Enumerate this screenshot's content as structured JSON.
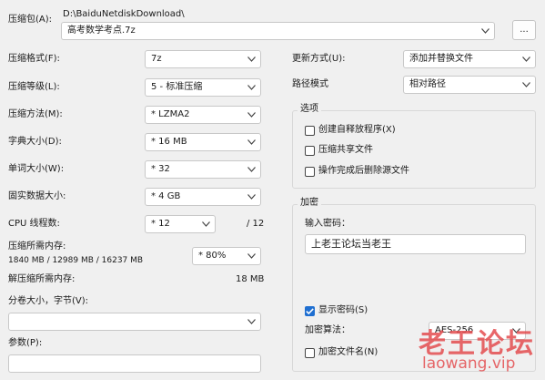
{
  "archive": {
    "label": "压缩包(A):",
    "path": "D:\\BaiduNetdiskDownload\\",
    "filename": "高考数学考点.7z",
    "browse_label": "..."
  },
  "left": {
    "format": {
      "label": "压缩格式(F):",
      "value": "7z"
    },
    "level": {
      "label": "压缩等级(L):",
      "value": "5 - 标准压缩"
    },
    "method": {
      "label": "压缩方法(M):",
      "value": "* LZMA2"
    },
    "dict": {
      "label": "字典大小(D):",
      "value": "* 16 MB"
    },
    "word": {
      "label": "单词大小(W):",
      "value": "* 32"
    },
    "solid": {
      "label": "固实数据大小:",
      "value": "* 4 GB"
    },
    "cpu": {
      "label": "CPU 线程数:",
      "value": "* 12",
      "total": "/ 12"
    },
    "memory": {
      "label": "压缩所需内存:",
      "detail": "1840 MB / 12989 MB / 16237 MB",
      "value": "* 80%"
    },
    "decomp": {
      "label": "解压缩所需内存:",
      "value": "18 MB"
    },
    "volume": {
      "label": "分卷大小，字节(V):",
      "value": ""
    },
    "params": {
      "label": "参数(P):",
      "value": ""
    }
  },
  "right": {
    "update": {
      "label": "更新方式(U):",
      "value": "添加并替换文件"
    },
    "pathmode": {
      "label": "路径模式",
      "value": "相对路径"
    },
    "options": {
      "title": "选项",
      "sfx": {
        "label": "创建自释放程序(X)",
        "checked": false
      },
      "shared": {
        "label": "压缩共享文件",
        "checked": false
      },
      "delete": {
        "label": "操作完成后删除源文件",
        "checked": false
      }
    },
    "encryption": {
      "title": "加密",
      "password_label": "输入密码：",
      "password_value": "上老王论坛当老王",
      "show_password": {
        "label": "显示密码(S)",
        "checked": true
      },
      "method_label": "加密算法：",
      "method_value": "AES-256",
      "encrypt_names": {
        "label": "加密文件名(N)",
        "checked": false
      }
    }
  },
  "watermark": {
    "line1": "老王论坛",
    "line2": "laowang.vip"
  }
}
